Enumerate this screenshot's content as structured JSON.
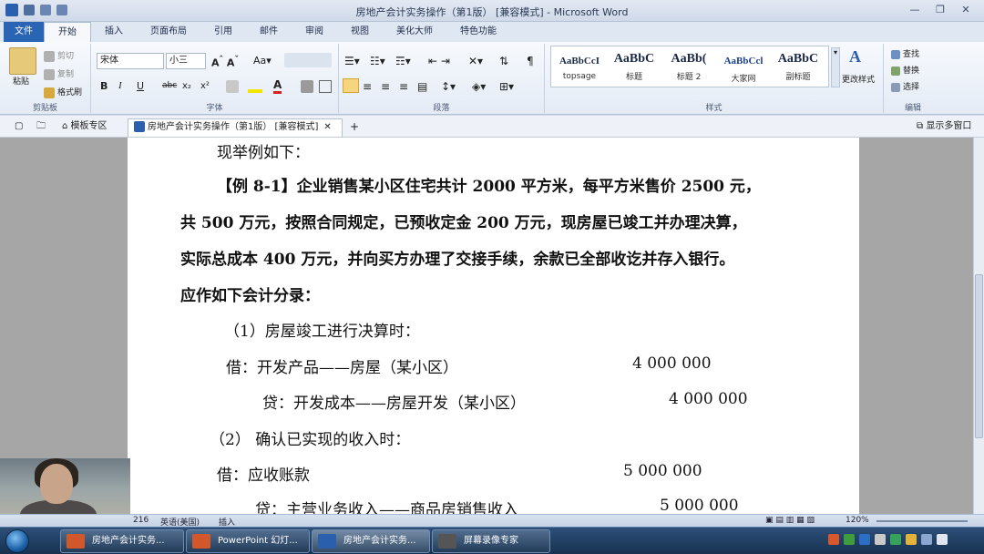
{
  "window": {
    "title": "房地产会计实务操作（第1版） [兼容模式] - Microsoft Word",
    "app_icon": "word-icon"
  },
  "ribbon_tabs": [
    "文件",
    "开始",
    "插入",
    "页面布局",
    "引用",
    "邮件",
    "审阅",
    "视图",
    "美化大师",
    "特色功能"
  ],
  "clipboard": {
    "paste": "粘贴",
    "cut": "剪切",
    "copy": "复制",
    "format_painter": "格式刷",
    "label": "剪贴板"
  },
  "font": {
    "name": "宋体",
    "size": "小三",
    "label": "字体",
    "bold": "B",
    "italic": "I",
    "underline": "U",
    "strike": "abc",
    "sub": "x₂",
    "sup": "x²"
  },
  "paragraph": {
    "label": "段落"
  },
  "styles": {
    "label": "样式",
    "items": [
      {
        "sample": "AaBbCcI",
        "name": "topsage"
      },
      {
        "sample": "AaBbC",
        "name": "标题"
      },
      {
        "sample": "AaBb(",
        "name": "标题 2"
      },
      {
        "sample": "AaBbCcl",
        "name": "大家网"
      },
      {
        "sample": "AaBbC",
        "name": "副标题"
      }
    ],
    "change_styles": "更改样式"
  },
  "editing": {
    "find": "查找",
    "replace": "替换",
    "select": "选择",
    "label": "编辑"
  },
  "doc_tabs": {
    "template": "模板专区",
    "current": "房地产会计实务操作（第1版） [兼容模式]",
    "show_multi": "显示多窗口"
  },
  "document": {
    "lines": [
      "现举例如下：",
      "【例 8-1】企业销售某小区住宅共计 2000 平方米，每平方米售价 2500 元，",
      "共 500 万元，按照合同规定，已预收定金 200 万元，现房屋已竣工并办理决算，",
      "实际总成本 400 万元，并向买方办理了交接手续，余款已全部收讫并存入银行。",
      "应作如下会计分录：",
      "（1）房屋竣工进行决算时：",
      "借：开发产品——房屋（某小区）",
      "4 000 000",
      "贷：开发成本——房屋开发（某小区）",
      "4 000 000",
      "（2）  确认已实现的收入时：",
      "借：应收账款",
      "5 000 000",
      "贷：主营业务收入——商品房销售收入",
      "5 000 000"
    ]
  },
  "statusbar": {
    "words": "216",
    "language": "英语(美国)",
    "mode": "插入",
    "zoom": "120%"
  },
  "taskbar": {
    "tasks": [
      "房地产会计实务...",
      "PowerPoint 幻灯...",
      "房地产会计实务...",
      "屏幕录像专家"
    ]
  }
}
